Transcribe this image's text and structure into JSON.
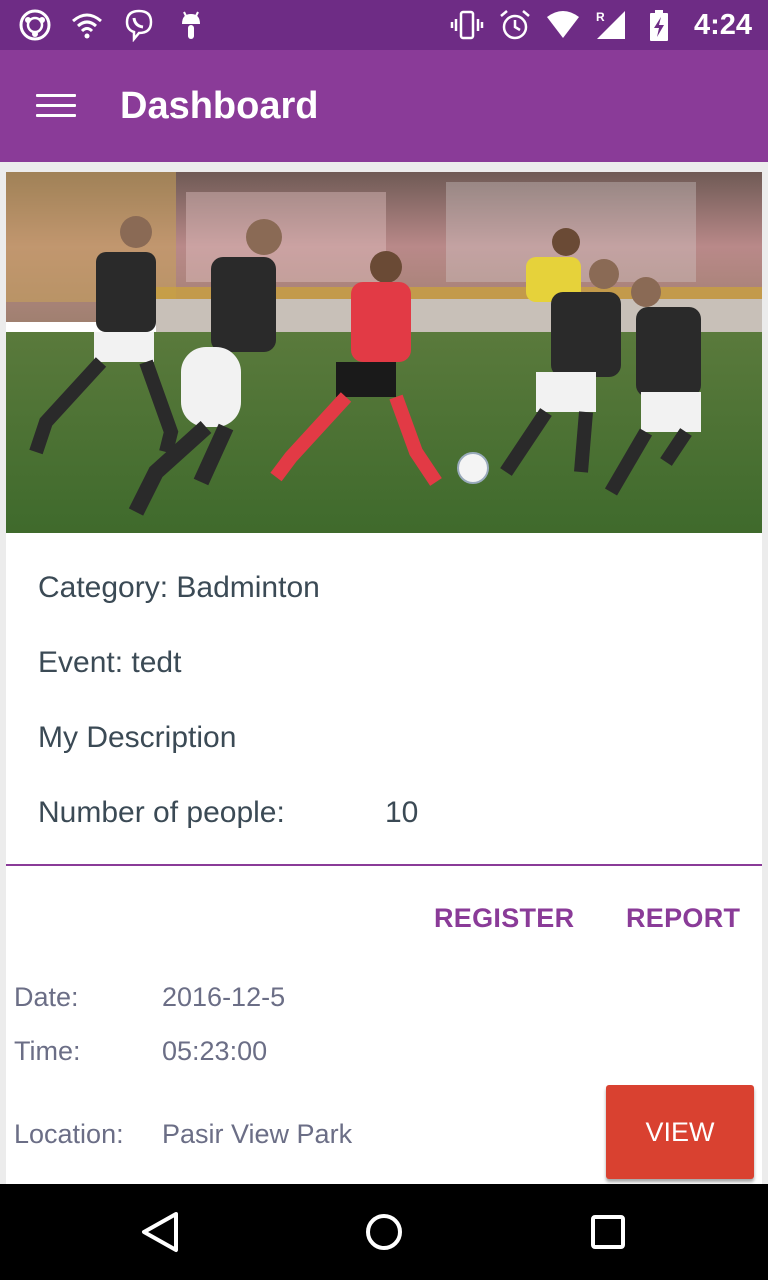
{
  "status_bar": {
    "time": "4:24",
    "left_icons": [
      "ubuntu-icon",
      "wifi-icon",
      "viber-icon",
      "android-icon"
    ],
    "right_icons": [
      "vibrate-icon",
      "alarm-icon",
      "wifi-signal-icon",
      "cell-signal-icon",
      "battery-icon"
    ],
    "cell_indicator": "R"
  },
  "app_bar": {
    "title": "Dashboard",
    "background": "#8a3b98",
    "status_background": "#6e2c85"
  },
  "card": {
    "category": "Category: Badminton",
    "event": "Event: tedt",
    "description": "My Description",
    "people_label": "Number of people:",
    "people_value": "10",
    "actions": {
      "register": "REGISTER",
      "report": "REPORT"
    },
    "date_label": "Date:",
    "date_value": "2016-12-5",
    "time_label": "Time:",
    "time_value": "05:23:00",
    "location_label": "Location:",
    "location_value": "Pasir View Park",
    "view_button": "VIEW",
    "accent": "#8a3b98",
    "view_color": "#d94130"
  },
  "nav_bar": {
    "icons": [
      "back-icon",
      "home-icon",
      "recents-icon"
    ]
  }
}
